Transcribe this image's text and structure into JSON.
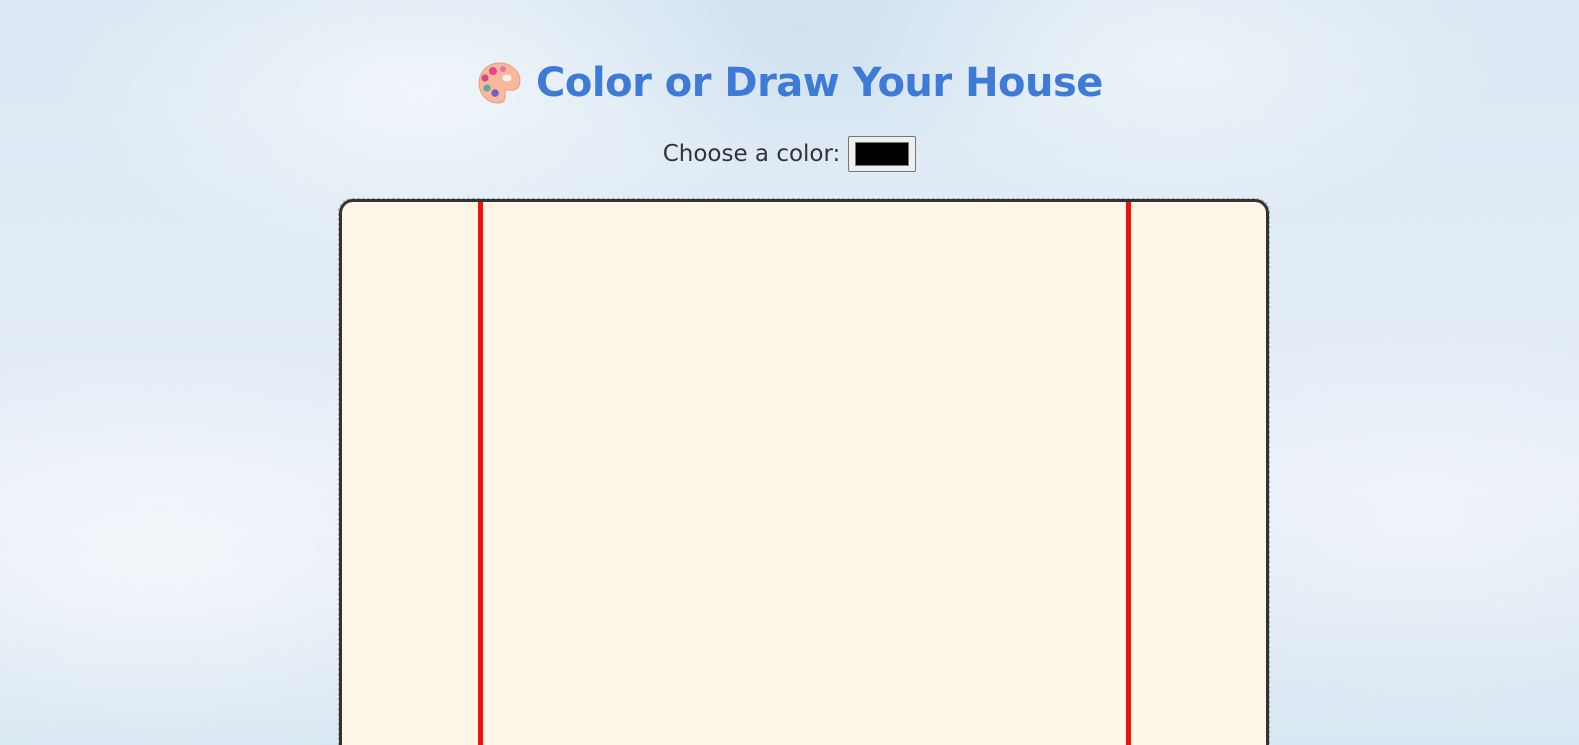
{
  "header": {
    "icon": "palette-icon",
    "title": "Color or Draw Your House"
  },
  "color_picker": {
    "label": "Choose a color:",
    "value": "#000000"
  },
  "canvas": {
    "background_color": "#fdf6e6",
    "border_color": "#333333",
    "stroke_color": "#ee1111"
  },
  "colors": {
    "title": "#3d7bd6",
    "label": "#333333"
  }
}
